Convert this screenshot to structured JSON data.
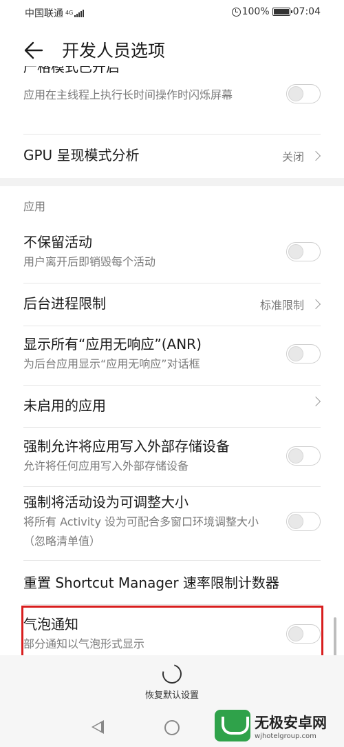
{
  "status_bar": {
    "carrier": "中国联通",
    "network": "4G",
    "battery": "100%",
    "time": "07:04"
  },
  "header": {
    "title": "开发人员选项"
  },
  "rows": {
    "partial_title": "严格模式已开启",
    "strict_mode_sub": "应用在主线程上执行长时间操作时闪烁屏幕",
    "gpu_title": "GPU 呈现模式分析",
    "gpu_value": "关闭",
    "section_apps": "应用",
    "dont_keep_title": "不保留活动",
    "dont_keep_sub": "用户离开后即销毁每个活动",
    "bg_limit_title": "后台进程限制",
    "bg_limit_value": "标准限制",
    "anr_title": "显示所有“应用无响应”(ANR)",
    "anr_sub": "为后台应用显示“应用无响应”对话框",
    "inactive_title": "未启用的应用",
    "force_external_title": "强制允许将应用写入外部存储设备",
    "force_external_sub": "允许将任何应用写入外部存储设备",
    "resizable_title": "强制将活动设为可调整大小",
    "resizable_sub": "将所有 Activity 设为可配合多窗口环境调整大小（忽略清单值）",
    "shortcut_title": "重置 Shortcut Manager 速率限制计数器",
    "bubbles_title": "气泡通知",
    "bubbles_sub": "部分通知以气泡形式显示"
  },
  "bottom": {
    "reset_label": "恢复默认设置"
  },
  "watermark": {
    "name": "无极安卓网",
    "url": "wjhotelgroup.com"
  },
  "toggles": {
    "strict_mode": false,
    "dont_keep": false,
    "anr": false,
    "force_external": false,
    "resizable": false,
    "bubbles": false
  },
  "colors": {
    "highlight": "#d81e1e",
    "logo": "#2fa24a"
  }
}
